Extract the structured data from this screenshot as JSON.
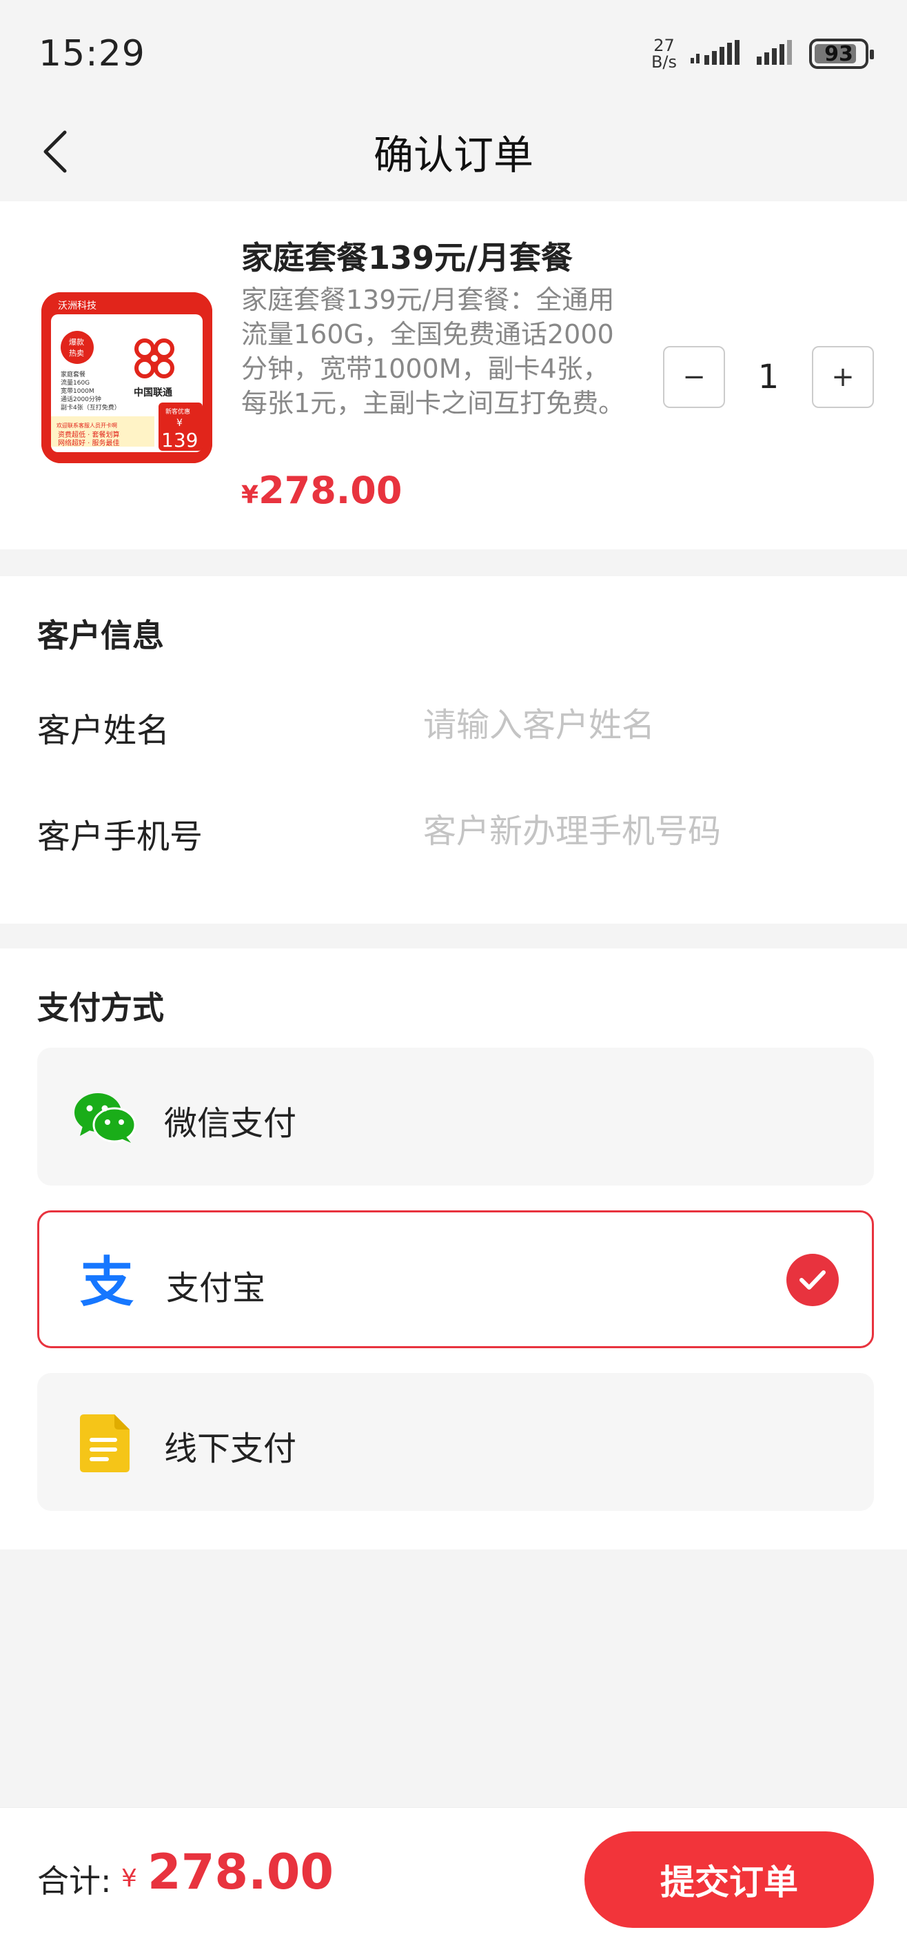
{
  "status": {
    "time": "15:29",
    "net_speed_value": "27",
    "net_speed_unit": "B/s",
    "battery": "93",
    "battery_level": 0.93
  },
  "nav": {
    "title": "确认订单"
  },
  "product": {
    "thumb": {
      "brand": "沃洲科技",
      "badge_top": "爆款",
      "badge_bottom": "热卖",
      "lines": [
        "家庭套餐",
        "流量160G",
        "宽带1000M",
        "通话2000分钟",
        "副卡4张（互打免费）"
      ],
      "operator": "中国联通",
      "monthly_label": "新客优惠",
      "currency": "¥",
      "price": "139",
      "footer_1": "欢迎联系客服人员开卡啊",
      "footer_2": "资费超低 · 套餐划算",
      "footer_3": "网络超好 · 服务最佳"
    },
    "title": "家庭套餐139元/月套餐",
    "description": "家庭套餐139元/月套餐：全通用流量160G，全国免费通话2000分钟，宽带1000M，副卡4张，每张1元，主副卡之间互打免费。",
    "price_symbol": "¥",
    "price": "278.00",
    "quantity": "1",
    "minus_label": "−",
    "plus_label": "+"
  },
  "customer": {
    "section_title": "客户信息",
    "name_label": "客户姓名",
    "name_placeholder": "请输入客户姓名",
    "phone_label": "客户手机号",
    "phone_placeholder": "客户新办理手机号码"
  },
  "payment": {
    "section_title": "支付方式",
    "options": [
      {
        "label": "微信支付",
        "icon": "wechat-icon",
        "selected": false
      },
      {
        "label": "支付宝",
        "icon": "alipay-icon",
        "selected": true
      },
      {
        "label": "线下支付",
        "icon": "document-icon",
        "selected": false
      }
    ],
    "alipay_glyph": "支"
  },
  "footer": {
    "total_label": "合计:",
    "total_symbol": "¥",
    "total_value": "278.00",
    "submit_label": "提交订单"
  },
  "colors": {
    "accent": "#e8333e",
    "wechat": "#1aad19",
    "alipay": "#1677ff",
    "offline": "#f5c518"
  }
}
